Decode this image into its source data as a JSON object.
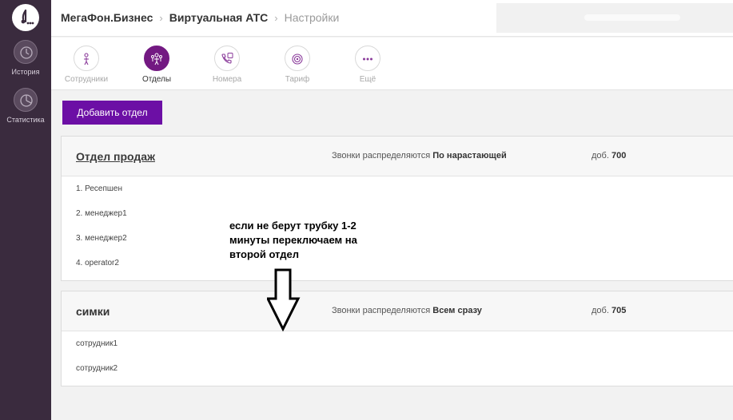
{
  "sidebar": {
    "logo": "megafon-logo",
    "items": [
      {
        "label": "История",
        "icon": "clock-icon"
      },
      {
        "label": "Статистика",
        "icon": "pie-chart-icon"
      }
    ]
  },
  "header": {
    "breadcrumbs": [
      "МегаФон.Бизнес",
      "Виртуальная АТС",
      "Настройки"
    ]
  },
  "tabs": [
    {
      "label": "Сотрудники",
      "icon": "person-icon",
      "active": false
    },
    {
      "label": "Отделы",
      "icon": "group-icon",
      "active": true
    },
    {
      "label": "Номера",
      "icon": "phone-icon",
      "active": false
    },
    {
      "label": "Тариф",
      "icon": "tariff-icon",
      "active": false
    },
    {
      "label": "Ещё",
      "icon": "more-icon",
      "active": false
    }
  ],
  "add_department_label": "Добавить отдел",
  "departments": [
    {
      "name": "Отдел продаж",
      "distribution_prefix": "Звонки распределяются",
      "distribution_mode": "По нарастающей",
      "ext_prefix": "доб.",
      "ext": "700",
      "members": [
        "1. Ресепшен",
        "2. менеджер1",
        "3. менеджер2",
        "4. operator2"
      ]
    },
    {
      "name": "симки",
      "distribution_prefix": "Звонки распределяются",
      "distribution_mode": "Всем сразу",
      "ext_prefix": "доб.",
      "ext": "705",
      "members": [
        "сотрудник1",
        "сотрудник2"
      ]
    }
  ],
  "annotation": {
    "lines": [
      "если не берут трубку 1-2",
      "минуты переключаем на",
      "второй отдел"
    ]
  },
  "colors": {
    "brand_purple": "#731982",
    "button_purple": "#6c0fa5",
    "sidebar_bg": "#3a2b3e"
  }
}
